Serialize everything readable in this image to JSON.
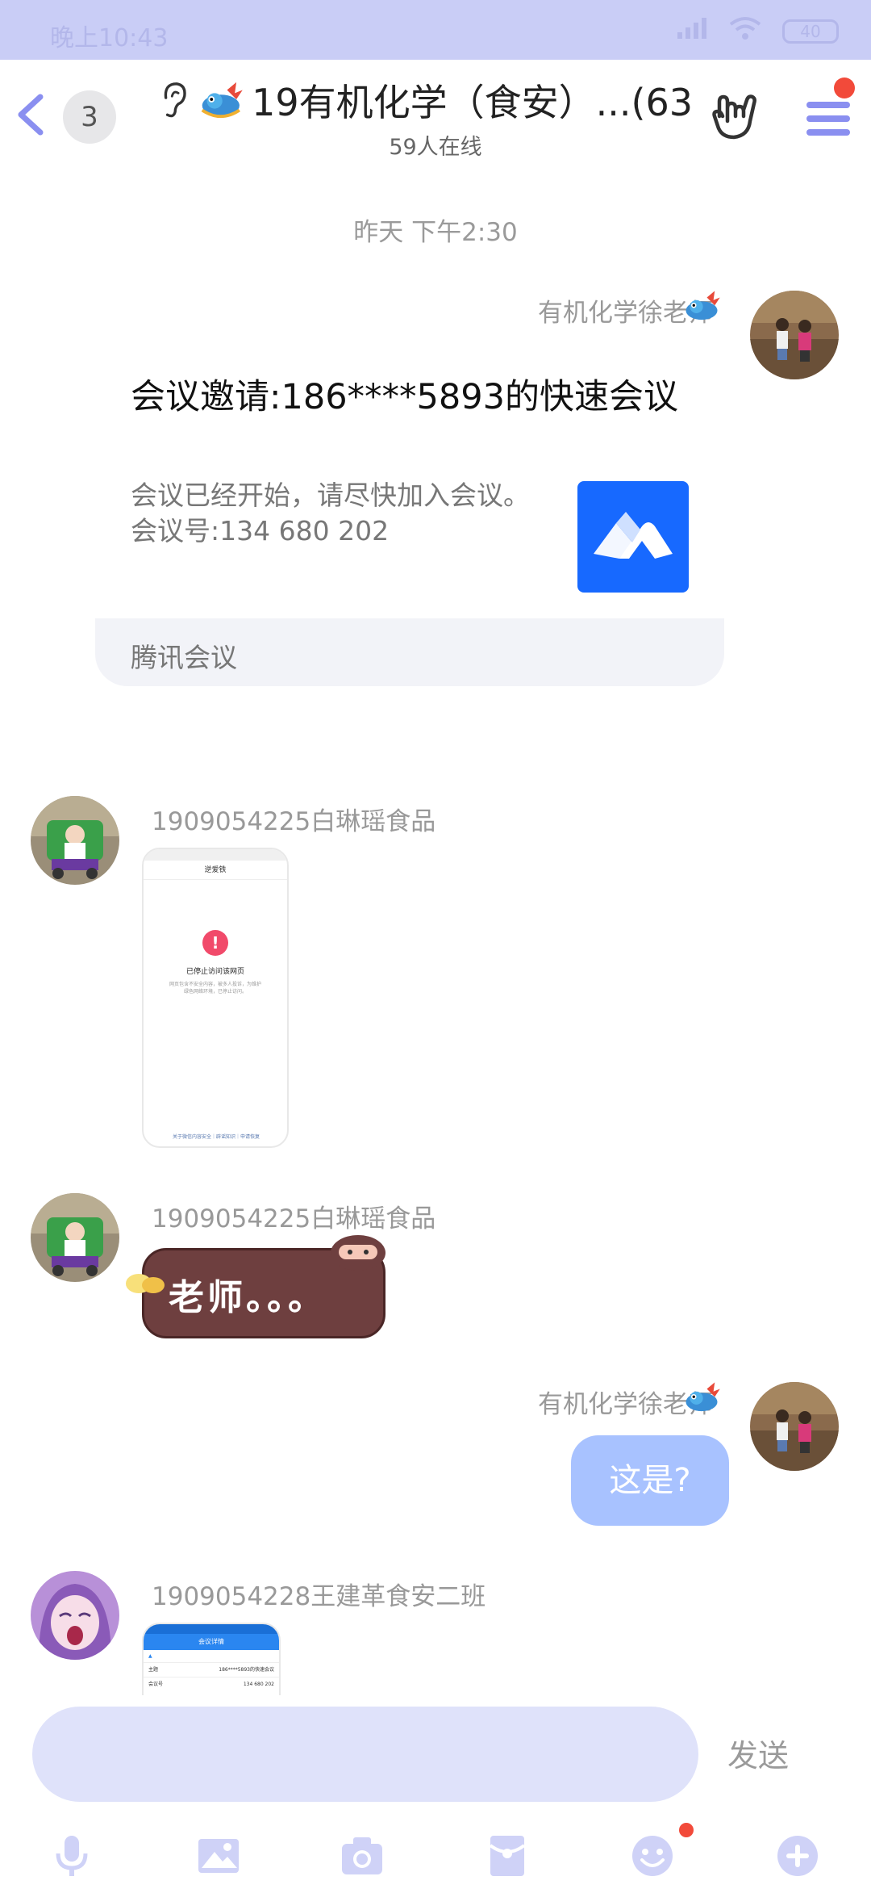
{
  "status_bar": {
    "time": "晚上10:43",
    "battery": "40"
  },
  "header": {
    "unread_count": "3",
    "group_title": "19有机化学（食安）...(63)",
    "online_text": "59人在线"
  },
  "timestamp": "昨天 下午2:30",
  "messages": [
    {
      "sender": "有机化学徐老师",
      "type": "meeting-card",
      "card_title": "会议邀请:186****5893的快速会议",
      "card_desc": "会议已经开始，请尽快加入会议。会议号:134 680 202",
      "card_source": "腾讯会议"
    },
    {
      "sender": "1909054225白琳瑶食品",
      "type": "image",
      "thumb_header": "逆爱铁",
      "thumb_title": "已停止访问该网页",
      "thumb_body": "网页包含不安全内容，被多人投诉，为维护绿色网络环境，已停止访问。",
      "thumb_footer": "关于微信内容安全｜辟谣知识｜申请恢复"
    },
    {
      "sender": "1909054225白琳瑶食品",
      "type": "sticker",
      "sticker_text": "老师。。。"
    },
    {
      "sender": "有机化学徐老师",
      "type": "text",
      "text": "这是?"
    },
    {
      "sender": "1909054228王建革食安二班",
      "type": "image",
      "thumb_header": "会议详情",
      "thumb_rows": [
        {
          "label": "主题",
          "value": "186****5893的快速会议"
        },
        {
          "label": "会议号",
          "value": "134 680 202"
        }
      ]
    }
  ],
  "input": {
    "placeholder": "",
    "send_label": "发送"
  },
  "toolbar": [
    "mic-icon",
    "image-icon",
    "camera-icon",
    "red-packet-icon",
    "emoji-icon",
    "plus-icon"
  ],
  "colors": {
    "accent": "#8a8ff0",
    "bubble_out": "#a8c2ff",
    "input_bg": "#dfe2fa",
    "badge_dot": "#f24a3a"
  }
}
